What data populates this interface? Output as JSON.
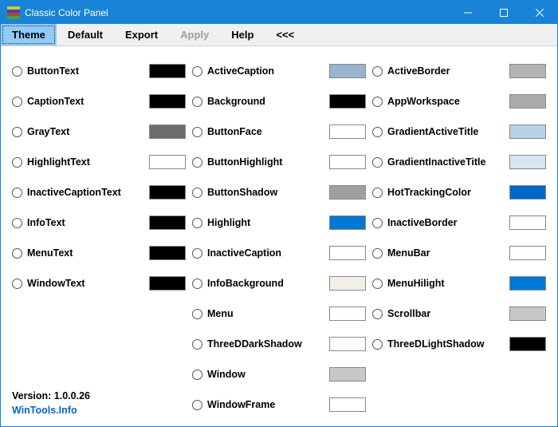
{
  "window": {
    "title": "Classic Color Panel",
    "icon_colors": [
      "#d7c13a",
      "#2a4fa8",
      "#c53a3a",
      "#3aa84b"
    ]
  },
  "menu": {
    "theme": "Theme",
    "default": "Default",
    "export": "Export",
    "apply": "Apply",
    "help": "Help",
    "collapse": "<<<"
  },
  "columns": [
    [
      {
        "name": "ButtonText",
        "color": "#000000"
      },
      {
        "name": "CaptionText",
        "color": "#000000"
      },
      {
        "name": "GrayText",
        "color": "#6d6d6d"
      },
      {
        "name": "HighlightText",
        "color": "#ffffff"
      },
      {
        "name": "InactiveCaptionText",
        "color": "#000000"
      },
      {
        "name": "InfoText",
        "color": "#000000"
      },
      {
        "name": "MenuText",
        "color": "#000000"
      },
      {
        "name": "WindowText",
        "color": "#000000"
      }
    ],
    [
      {
        "name": "ActiveCaption",
        "color": "#99b4d1"
      },
      {
        "name": "Background",
        "color": "#000000"
      },
      {
        "name": "ButtonFace",
        "color": "#ffffff"
      },
      {
        "name": "ButtonHighlight",
        "color": "#ffffff"
      },
      {
        "name": "ButtonShadow",
        "color": "#a0a0a0"
      },
      {
        "name": "Highlight",
        "color": "#0078d7"
      },
      {
        "name": "InactiveCaption",
        "color": "#ffffff"
      },
      {
        "name": "InfoBackground",
        "color": "#f2f0e6"
      },
      {
        "name": "Menu",
        "color": "#ffffff"
      },
      {
        "name": "ThreeDDarkShadow",
        "color": "#ffffff"
      },
      {
        "name": "Window",
        "color": "#c8c8c8"
      },
      {
        "name": "WindowFrame",
        "color": "#ffffff"
      }
    ],
    [
      {
        "name": "ActiveBorder",
        "color": "#b4b4b4"
      },
      {
        "name": "AppWorkspace",
        "color": "#ababab"
      },
      {
        "name": "GradientActiveTitle",
        "color": "#b9d1ea"
      },
      {
        "name": "GradientInactiveTitle",
        "color": "#d7e4f2"
      },
      {
        "name": "HotTrackingColor",
        "color": "#0066cc"
      },
      {
        "name": "InactiveBorder",
        "color": "#ffffff"
      },
      {
        "name": "MenuBar",
        "color": "#ffffff"
      },
      {
        "name": "MenuHilight",
        "color": "#0078d7"
      },
      {
        "name": "Scrollbar",
        "color": "#c8c8c8"
      },
      {
        "name": "ThreeDLightShadow",
        "color": "#000000"
      }
    ]
  ],
  "footer": {
    "version_label": "Version: 1.0.0.26",
    "link_text": "WinTools.Info"
  }
}
